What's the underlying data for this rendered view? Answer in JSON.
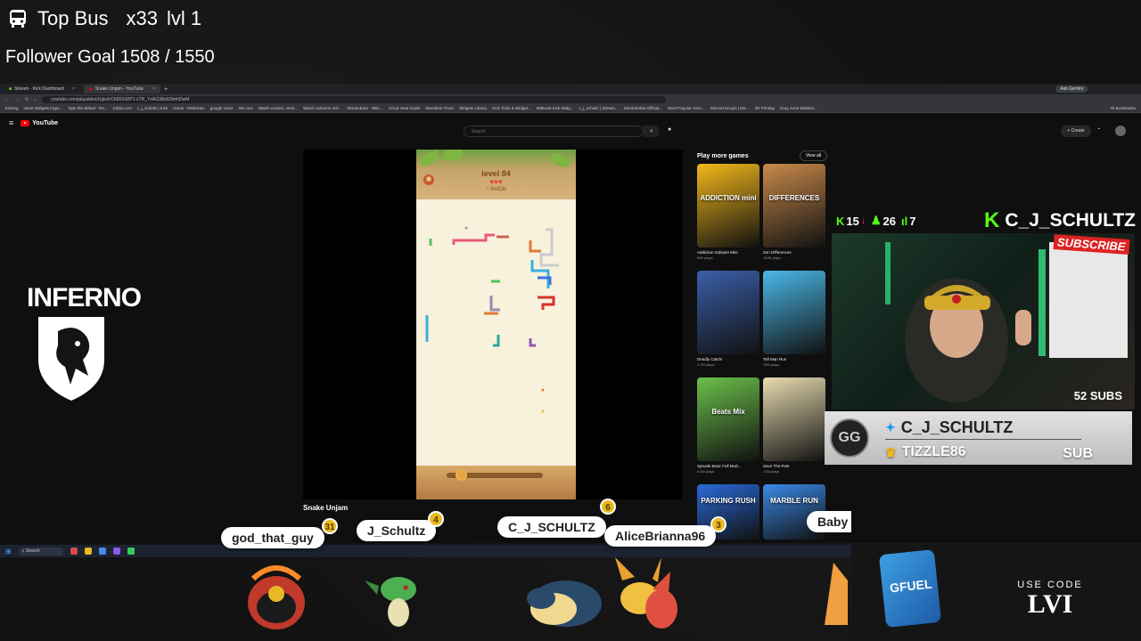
{
  "overlay": {
    "top_bus": "Top Bus",
    "multiplier": "x33",
    "level": "lvl 1",
    "follower_goal": "Follower Goal 1508 / 1550"
  },
  "browser": {
    "tabs": [
      {
        "label": "Stream - Kick Dashboard",
        "icon": "kick-icon"
      },
      {
        "label": "Snake Unjam - YouTube",
        "icon": "youtube-icon"
      }
    ],
    "url": "youtube.com/playables/UgkxhCK80Xd2P1-xTR_YxAG3Ba52bhhDwM",
    "ask_gemini": "Ask Gemini",
    "bookmarks": [
      "Kicking",
      "Heart Widgets Hype...",
      "Spin the Wheel - Ra...",
      "Clubs.com",
      "c_j_schultz | Kick",
      "Home - Restream",
      "google Voice",
      "Wu.com",
      "Watch movies, serie...",
      "Watch cartoons onli...",
      "StreamEast - NBA...",
      "Cricut Heat Guide",
      "Marathon Timer",
      "Widgets Library",
      "Kick Tools & Widget...",
      "MrBoost Kick Widg...",
      "c_j_schultz | Stream...",
      "Streamerbot Official...",
      "Most Popular Anim...",
      "Discord Emojis | Dis...",
      "3D Printing",
      "Gray Zone Warfare...",
      "All Bookmarks"
    ]
  },
  "youtube": {
    "logo": "YouTube",
    "search_placeholder": "Search",
    "create_label": "Create",
    "video_title": "Snake Unjam",
    "game": {
      "level": "level 84",
      "timer": "9m53s"
    },
    "play_more_games": {
      "heading": "Play more games",
      "view_all": "View all",
      "games": [
        {
          "title": "Addiction Solitaire Mini",
          "plays": "69K plays",
          "thumb_text": "ADDICTION mini",
          "color": "#f3b81a"
        },
        {
          "title": "Zen Differences",
          "plays": "143K plays",
          "thumb_text": "DIFFERENCES",
          "color": "#c98a4a"
        },
        {
          "title": "Deadly Catch!",
          "plays": "2.7M plays",
          "thumb_text": "",
          "color": "#3a5fa8"
        },
        {
          "title": "Tall Man Run",
          "plays": "78M plays",
          "thumb_text": "",
          "color": "#4ab8e8"
        },
        {
          "title": "Sprunki Beat: Full Mod...",
          "plays": "6.5M plays",
          "thumb_text": "Beats Mix",
          "color": "#6cc04a"
        },
        {
          "title": "Save The Pets",
          "plays": "17M plays",
          "thumb_text": "",
          "color": "#e8dcb0"
        },
        {
          "title": "",
          "plays": "",
          "thumb_text": "PARKING RUSH",
          "color": "#2a6ad8"
        },
        {
          "title": "",
          "plays": "",
          "thumb_text": "MARBLE RUN",
          "color": "#3a8ae8"
        }
      ]
    }
  },
  "webcam": {
    "kick_count": "15",
    "follow_count": "26",
    "viewer_count": "7",
    "channel": "C_J_SCHULTZ",
    "subscribe_banner": "SUBSCRIBE",
    "subs": "52 SUBS",
    "twitter": "C_J_SCHULTZ",
    "latest_sub": "TIZZLE86",
    "sub_label": "SUB"
  },
  "logo": {
    "text": "INFERNO"
  },
  "chatters": [
    {
      "name": "god_that_guy",
      "level": "31"
    },
    {
      "name": "J_Schultz",
      "level": "4"
    },
    {
      "name": "C_J_SCHULTZ",
      "level": "6"
    },
    {
      "name": "AliceBrianna96",
      "level": "3"
    },
    {
      "name": "Baby",
      "level": ""
    }
  ],
  "taskbar": {
    "search_placeholder": "Search"
  },
  "sponsor": {
    "use_code": "USE CODE",
    "code": "LVI",
    "product": "GFUEL"
  },
  "colors": {
    "kick_green": "#53fc18",
    "youtube_red": "#ff0000",
    "level_badge": "#e8b923"
  }
}
